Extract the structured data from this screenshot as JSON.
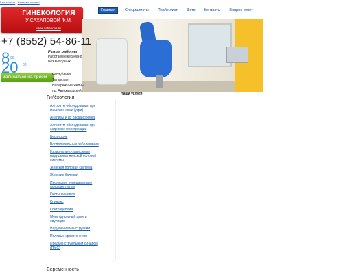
{
  "top_links": {
    "map": "Карта сайта",
    "search": "Написать письмо",
    "sep": "|"
  },
  "logo": {
    "title": "ГИНЕКОЛОГИЯ",
    "subtitle": "У САХАПОВОЙ Ф.М.",
    "site": "www.sahapova.ru"
  },
  "nav": [
    "Главная",
    "Специалисты",
    "Прайс-лист",
    "Фото",
    "Контакты",
    "Вопрос-ответ"
  ],
  "phone": "+7 (8552) 54-86-11",
  "hours": {
    "open_h": "8",
    "open_m": "00",
    "close_h": "20",
    "close_m": "00"
  },
  "regime": {
    "title": "Режим работы",
    "line1": "Работаем ежедневно",
    "line2": "Без выходных"
  },
  "signup_button": "Записаться на прием",
  "address": {
    "line1": "Республика Татарстан",
    "line2": "Набережные Челны",
    "line3": "пр. Автозаводский, 17"
  },
  "section_title": "Гинекология",
  "services_title": "Наши услуги",
  "sidebar_links": [
    "Алгоритм обследования при",
    "мишенях кожи (угри)",
    "Анализы и их расшифровка",
    "Алгоритм обследования при",
    "задержке менструации",
    "Бесплодие",
    "Воспалительные заболевания",
    "Гормонально-зависимые",
    "нарушения женской половой",
    "системы",
    "Женская половая система",
    "Женские болезни",
    "Инфекции, передаваемые",
    "половым путем",
    "Кисты яичников",
    "Климакс",
    "Контрацепция",
    "Менструальный цикл и",
    "овуляция",
    "Нарушения менструации",
    "Половые кровотечения",
    "Предменструальный синдром",
    "(ПМС)"
  ],
  "bottom_title": "Беременность",
  "colors": {
    "brand_red": "#d4181b",
    "link_blue": "#1a5ea8",
    "accent_blue": "#2a8fe0",
    "button_green": "#6fb42a"
  }
}
